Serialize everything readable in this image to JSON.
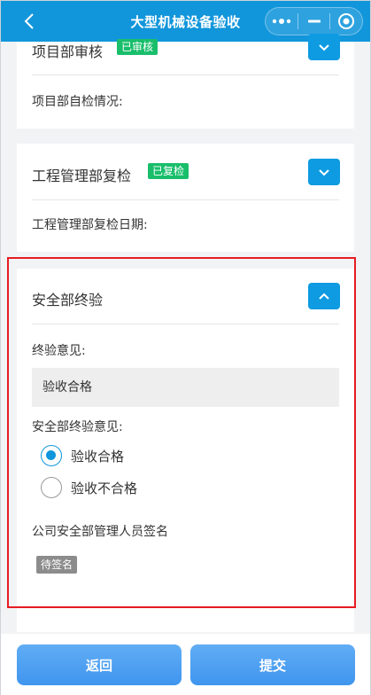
{
  "navbar": {
    "title": "大型机械设备验收"
  },
  "sections": {
    "project": {
      "title": "项目部审核",
      "badge": "已审核",
      "field": "项目部自检情况:"
    },
    "engineering": {
      "title": "工程管理部复检",
      "badge": "已复检",
      "field": "工程管理部复检日期:"
    },
    "safety": {
      "title": "安全部终验",
      "opinion_label": "终验意见:",
      "opinion_value": "验收合格",
      "radio_label": "安全部终验意见:",
      "options": [
        {
          "label": "验收合格",
          "checked": true
        },
        {
          "label": "验收不合格",
          "checked": false
        }
      ],
      "signature_label": "公司安全部管理人员签名",
      "signature_status": "待签名"
    }
  },
  "footer": {
    "back_label": "返回",
    "submit_label": "提交"
  },
  "colors": {
    "primary": "#1296db",
    "badge_green": "#19be6b",
    "highlight_red": "#e51c23"
  }
}
